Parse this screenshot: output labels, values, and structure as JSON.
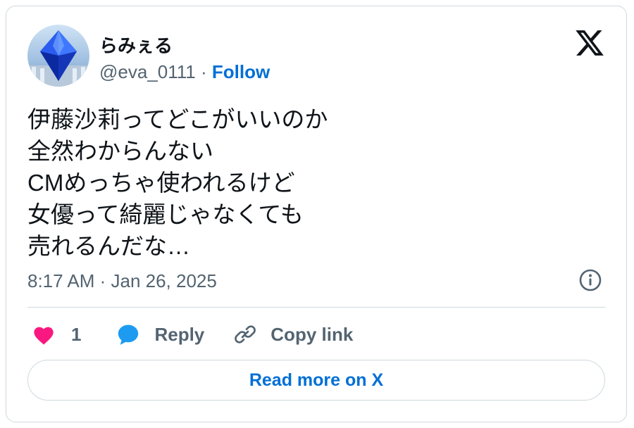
{
  "author": {
    "display_name": "らみぇる",
    "handle": "@eva_0111",
    "separator": "·",
    "follow_label": "Follow"
  },
  "tweet": {
    "text": "伊藤沙莉ってどこがいいのか\n全然わからんない\nCMめっちゃ使われるけど\n女優って綺麗じゃなくても\n売れるんだな…",
    "timestamp": "8:17 AM · Jan 26, 2025"
  },
  "actions": {
    "like_count": "1",
    "reply_label": "Reply",
    "copy_link_label": "Copy link"
  },
  "read_more_label": "Read more on X",
  "colors": {
    "like": "#f91880",
    "reply": "#1d9bf0",
    "link": "#006fd6",
    "muted": "#536471",
    "border": "#cfd9de"
  },
  "icons": [
    "x-logo-icon",
    "info-icon",
    "heart-icon",
    "reply-bubble-icon",
    "link-icon"
  ]
}
